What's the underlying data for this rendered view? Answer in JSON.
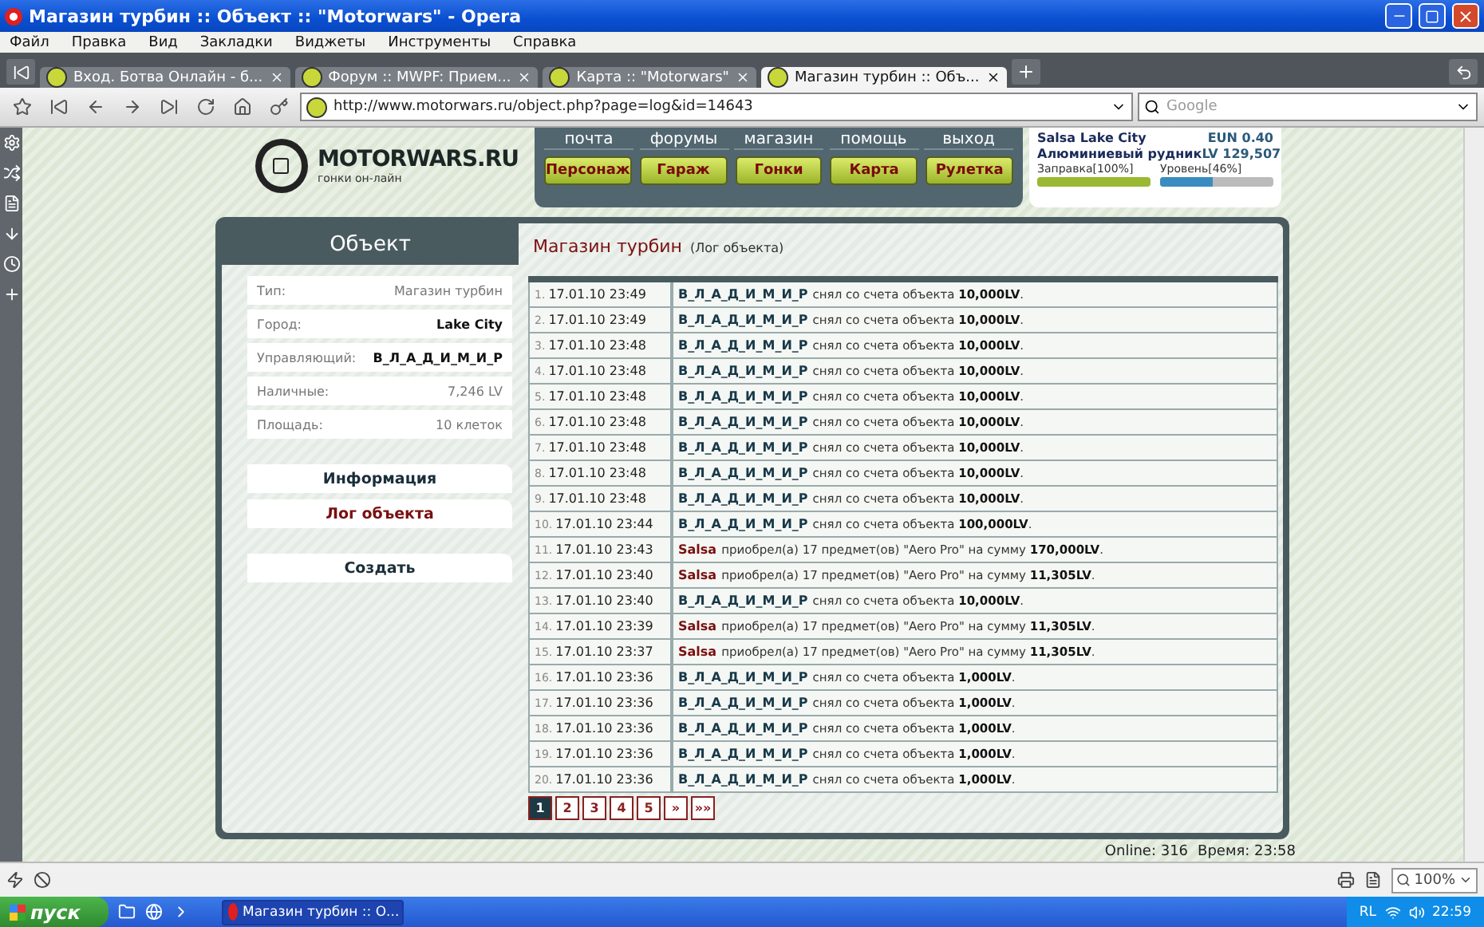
{
  "window": {
    "title": "Магазин турбин :: Объект :: \"Motorwars\" - Opera"
  },
  "menu": [
    "Файл",
    "Правка",
    "Вид",
    "Закладки",
    "Виджеты",
    "Инструменты",
    "Справка"
  ],
  "tabs": [
    {
      "label": "Вход. Ботва Онлайн - б...",
      "selected": false
    },
    {
      "label": "Форум :: MWPF: Прием...",
      "selected": false
    },
    {
      "label": "Карта :: \"Motorwars\"",
      "selected": false
    },
    {
      "label": "Магазин турбин :: Объ...",
      "selected": true
    }
  ],
  "address": {
    "url": "http://www.motorwars.ru/object.php?page=log&id=14643",
    "search_placeholder": "Google"
  },
  "site": {
    "logo": "MOTORWARS.RU",
    "tagline": "гонки он-лайн",
    "top_links": [
      "почта",
      "форумы",
      "магазин",
      "помощь",
      "выход"
    ],
    "nav_buttons": [
      "Персонаж",
      "Гараж",
      "Гонки",
      "Карта",
      "Рулетка"
    ],
    "player": {
      "name": "Salsa Lake City",
      "currency": "EUN 0.40",
      "mine": "Алюминиевый рудник",
      "money": "LV 129,507",
      "meters": [
        {
          "label": "Заправка[100%]",
          "level": 1.0,
          "color": "#9ab832"
        },
        {
          "label": "Уровень[46%]",
          "level": 0.46,
          "color": "#3a8cc0"
        }
      ]
    }
  },
  "object_panel": {
    "title": "Объект",
    "fields": [
      {
        "label": "Тип:",
        "value": "Магазин турбин",
        "emphasis": false
      },
      {
        "label": "Город:",
        "value": "Lake City",
        "emphasis": true
      },
      {
        "label": "Управляющий:",
        "value": "В_Л_А_Д_И_М_И_Р",
        "emphasis": true
      },
      {
        "label": "Наличные:",
        "value": "7,246 LV",
        "emphasis": false
      },
      {
        "label": "Площадь:",
        "value": "10 клеток",
        "emphasis": false
      }
    ],
    "menu": [
      {
        "label": "Информация",
        "selected": false
      },
      {
        "label": "Лог объекта",
        "selected": true
      }
    ],
    "actions": [
      "Создать"
    ]
  },
  "log": {
    "title": "Магазин турбин",
    "subtitle": "(Лог объекта)",
    "rows": [
      {
        "num": "1.",
        "time": "17.01.10 23:49",
        "kind": "withdraw",
        "actor": "В_Л_А_Д_И_М_И_Р",
        "message": "снял со счета объекта **10,000LV**."
      },
      {
        "num": "2.",
        "time": "17.01.10 23:49",
        "kind": "withdraw",
        "actor": "В_Л_А_Д_И_М_И_Р",
        "message": "снял со счета объекта **10,000LV**."
      },
      {
        "num": "3.",
        "time": "17.01.10 23:48",
        "kind": "withdraw",
        "actor": "В_Л_А_Д_И_М_И_Р",
        "message": "снял со счета объекта **10,000LV**."
      },
      {
        "num": "4.",
        "time": "17.01.10 23:48",
        "kind": "withdraw",
        "actor": "В_Л_А_Д_И_М_И_Р",
        "message": "снял со счета объекта **10,000LV**."
      },
      {
        "num": "5.",
        "time": "17.01.10 23:48",
        "kind": "withdraw",
        "actor": "В_Л_А_Д_И_М_И_Р",
        "message": "снял со счета объекта **10,000LV**."
      },
      {
        "num": "6.",
        "time": "17.01.10 23:48",
        "kind": "withdraw",
        "actor": "В_Л_А_Д_И_М_И_Р",
        "message": "снял со счета объекта **10,000LV**."
      },
      {
        "num": "7.",
        "time": "17.01.10 23:48",
        "kind": "withdraw",
        "actor": "В_Л_А_Д_И_М_И_Р",
        "message": "снял со счета объекта **10,000LV**."
      },
      {
        "num": "8.",
        "time": "17.01.10 23:48",
        "kind": "withdraw",
        "actor": "В_Л_А_Д_И_М_И_Р",
        "message": "снял со счета объекта **10,000LV**."
      },
      {
        "num": "9.",
        "time": "17.01.10 23:48",
        "kind": "withdraw",
        "actor": "В_Л_А_Д_И_М_И_Р",
        "message": "снял со счета объекта **10,000LV**."
      },
      {
        "num": "10.",
        "time": "17.01.10 23:44",
        "kind": "withdraw",
        "actor": "В_Л_А_Д_И_М_И_Р",
        "message": "снял со счета объекта **100,000LV**."
      },
      {
        "num": "11.",
        "time": "17.01.10 23:43",
        "kind": "purchase",
        "actor": "Salsa",
        "message": "приобрел(а) 17 предмет(ов) \"Aero Pro\" на сумму **170,000LV**."
      },
      {
        "num": "12.",
        "time": "17.01.10 23:40",
        "kind": "purchase",
        "actor": "Salsa",
        "message": "приобрел(а) 17 предмет(ов) \"Aero Pro\" на сумму **11,305LV**."
      },
      {
        "num": "13.",
        "time": "17.01.10 23:40",
        "kind": "withdraw",
        "actor": "В_Л_А_Д_И_М_И_Р",
        "message": "снял со счета объекта **10,000LV**."
      },
      {
        "num": "14.",
        "time": "17.01.10 23:39",
        "kind": "purchase",
        "actor": "Salsa",
        "message": "приобрел(а) 17 предмет(ов) \"Aero Pro\" на сумму **11,305LV**."
      },
      {
        "num": "15.",
        "time": "17.01.10 23:37",
        "kind": "purchase",
        "actor": "Salsa",
        "message": "приобрел(а) 17 предмет(ов) \"Aero Pro\" на сумму **11,305LV**."
      },
      {
        "num": "16.",
        "time": "17.01.10 23:36",
        "kind": "withdraw",
        "actor": "В_Л_А_Д_И_М_И_Р",
        "message": "снял со счета объекта **1,000LV**."
      },
      {
        "num": "17.",
        "time": "17.01.10 23:36",
        "kind": "withdraw",
        "actor": "В_Л_А_Д_И_М_И_Р",
        "message": "снял со счета объекта **1,000LV**."
      },
      {
        "num": "18.",
        "time": "17.01.10 23:36",
        "kind": "withdraw",
        "actor": "В_Л_А_Д_И_М_И_Р",
        "message": "снял со счета объекта **1,000LV**."
      },
      {
        "num": "19.",
        "time": "17.01.10 23:36",
        "kind": "withdraw",
        "actor": "В_Л_А_Д_И_М_И_Р",
        "message": "снял со счета объекта **1,000LV**."
      },
      {
        "num": "20.",
        "time": "17.01.10 23:36",
        "kind": "withdraw",
        "actor": "В_Л_А_Д_И_М_И_Р",
        "message": "снял со счета объекта **1,000LV**."
      }
    ],
    "pages": [
      {
        "label": "1",
        "selected": true
      },
      {
        "label": "2",
        "selected": false
      },
      {
        "label": "3",
        "selected": false
      },
      {
        "label": "4",
        "selected": false
      },
      {
        "label": "5",
        "selected": false
      },
      {
        "label": "»",
        "selected": false
      },
      {
        "label": "»»",
        "selected": false
      }
    ]
  },
  "site_status": {
    "online": "Online: 316",
    "time": "Время: 23:58"
  },
  "browser_status": {
    "zoom": "100%"
  },
  "taskbar": {
    "start": "пуск",
    "task": "Магазин турбин :: О...",
    "lang": "RL",
    "clock": "22:59"
  }
}
